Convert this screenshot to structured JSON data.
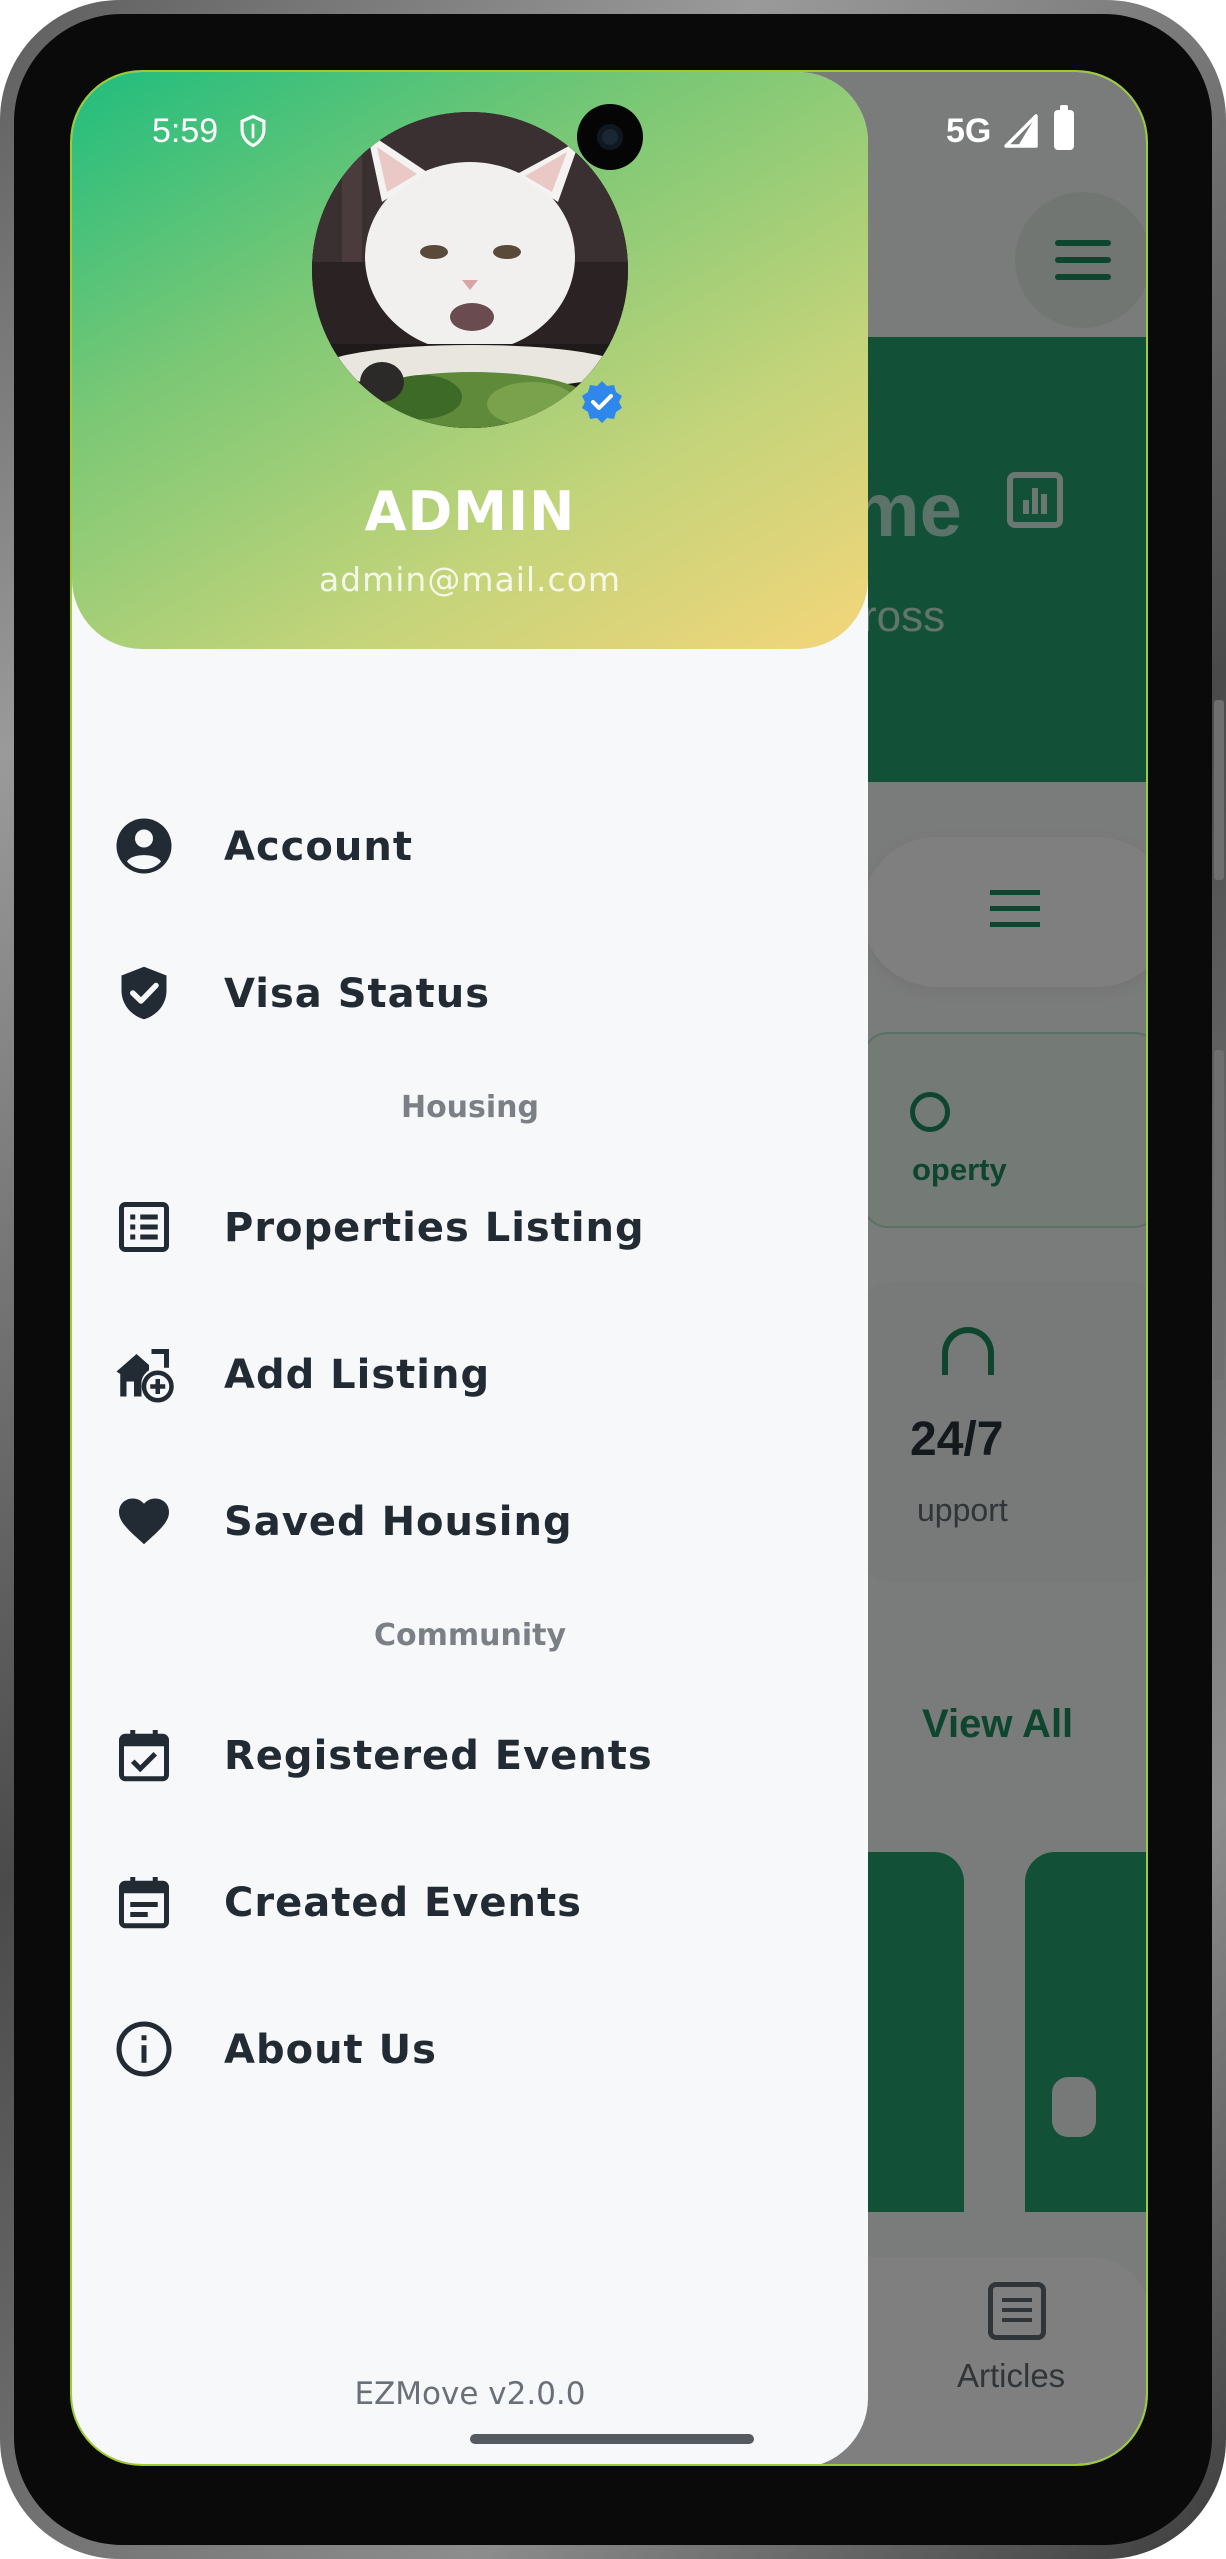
{
  "status_bar": {
    "time": "5:59",
    "network": "5G"
  },
  "background_screen": {
    "hero_title": "me",
    "hero_subtitle": "ross",
    "card_label": "operty",
    "support_value": "24/7",
    "support_label": "upport",
    "view_all": "View All",
    "bottom_nav_label": "Articles"
  },
  "drawer": {
    "profile": {
      "name": "ADMIN",
      "email": "admin@mail.com"
    },
    "items": [
      {
        "label": "Account",
        "icon": "account-circle-icon"
      },
      {
        "label": "Visa Status",
        "icon": "shield-check-icon"
      }
    ],
    "sections": [
      {
        "title": "Housing",
        "items": [
          {
            "label": "Properties Listing",
            "icon": "list-icon"
          },
          {
            "label": "Add Listing",
            "icon": "add-home-icon"
          },
          {
            "label": "Saved Housing",
            "icon": "heart-icon"
          }
        ]
      },
      {
        "title": "Community",
        "items": [
          {
            "label": "Registered Events",
            "icon": "event-available-icon"
          },
          {
            "label": "Created Events",
            "icon": "event-note-icon"
          },
          {
            "label": "About Us",
            "icon": "info-icon"
          }
        ]
      }
    ],
    "version": "EZMove v2.0.0"
  },
  "colors": {
    "accent": "#1D8A5C",
    "header_start": "#1FBD7E",
    "header_end": "#F4D57A",
    "text": "#222A33",
    "verified": "#2F86EB"
  }
}
